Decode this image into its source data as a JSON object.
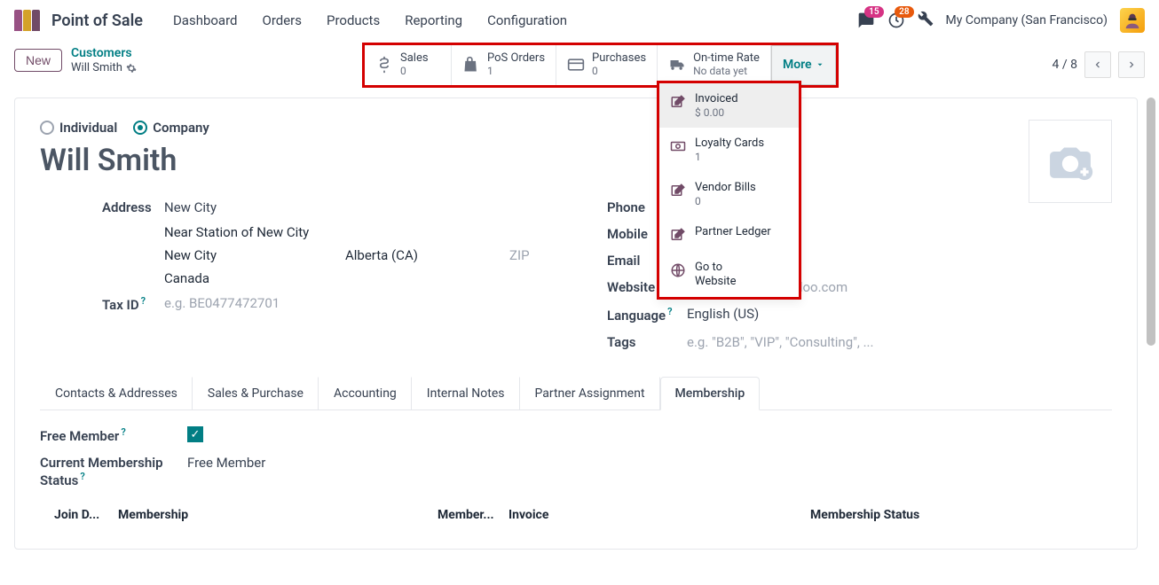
{
  "nav": {
    "app": "Point of Sale",
    "links": [
      "Dashboard",
      "Orders",
      "Products",
      "Reporting",
      "Configuration"
    ],
    "discuss_badge": "15",
    "activity_badge": "28",
    "company": "My Company (San Francisco)"
  },
  "controlbar": {
    "new_label": "New",
    "breadcrumb_top": "Customers",
    "breadcrumb_bottom": "Will Smith"
  },
  "pager": {
    "text": "4 / 8"
  },
  "statboxes": [
    {
      "label": "Sales",
      "value": "0"
    },
    {
      "label": "PoS Orders",
      "value": "1"
    },
    {
      "label": "Purchases",
      "value": "0"
    },
    {
      "label": "On-time Rate",
      "value": "No data yet"
    }
  ],
  "more_label": "More",
  "dropdown": [
    {
      "label": "Invoiced",
      "value": "$ 0.00"
    },
    {
      "label": "Loyalty Cards",
      "value": "1"
    },
    {
      "label": "Vendor Bills",
      "value": "0"
    },
    {
      "label": "Partner Ledger",
      "value": ""
    },
    {
      "label": "Go to Website",
      "value": ""
    }
  ],
  "record": {
    "type_individual": "Individual",
    "type_company": "Company",
    "name": "Will Smith",
    "address_label": "Address",
    "street": "New City",
    "street2": "Near Station of New City",
    "city": "New City",
    "state": "Alberta (CA)",
    "zip_placeholder": "ZIP",
    "country": "Canada",
    "tax_label": "Tax ID",
    "tax_placeholder": "e.g. BE0477472701",
    "phone_label": "Phone",
    "mobile_label": "Mobile",
    "email_label": "Email",
    "website_label": "Website",
    "website_placeholder": "e.g. https://www.odoo.com",
    "language_label": "Language",
    "language_value": "English (US)",
    "tags_label": "Tags",
    "tags_placeholder": "e.g. \"B2B\", \"VIP\", \"Consulting\", ..."
  },
  "tabs": [
    "Contacts & Addresses",
    "Sales & Purchase",
    "Accounting",
    "Internal Notes",
    "Partner Assignment",
    "Membership"
  ],
  "membership": {
    "free_label": "Free Member",
    "status_label": "Current Membership Status",
    "status_value": "Free Member",
    "cols": [
      "Join D...",
      "Membership",
      "Member...",
      "Invoice",
      "Membership Status"
    ]
  }
}
